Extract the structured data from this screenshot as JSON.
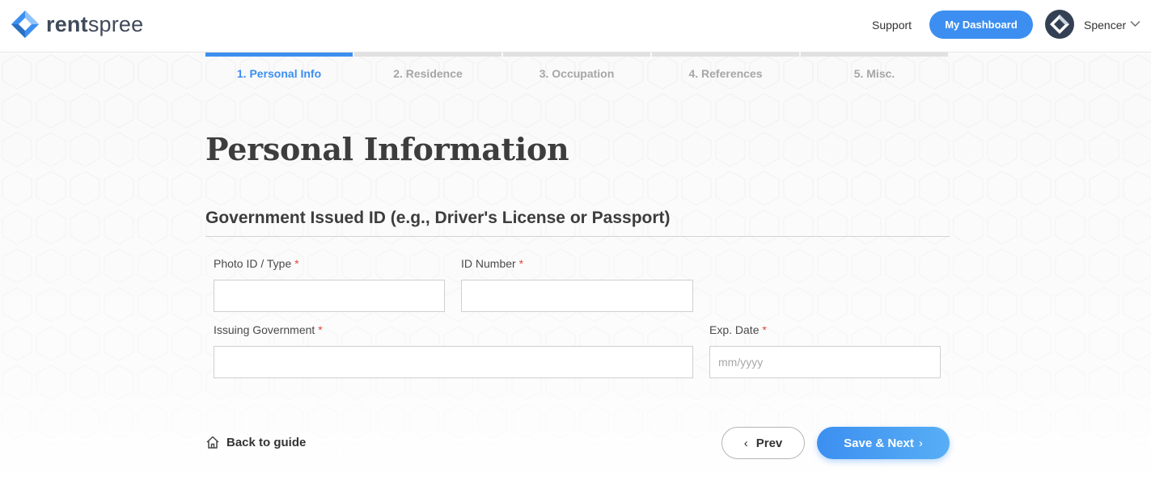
{
  "header": {
    "logo_text_strong": "rent",
    "logo_text_rest": "spree",
    "support_label": "Support",
    "dashboard_label": "My Dashboard",
    "user_name": "Spencer",
    "brand_color": "#3c8ff0"
  },
  "steps": [
    {
      "label": "1. Personal Info",
      "active": true
    },
    {
      "label": "2. Residence",
      "active": false
    },
    {
      "label": "3. Occupation",
      "active": false
    },
    {
      "label": "4. References",
      "active": false
    },
    {
      "label": "5. Misc.",
      "active": false
    }
  ],
  "page_title": "Personal Information",
  "section_title": "Government Issued ID (e.g., Driver's License or Passport)",
  "fields": {
    "photo_id": {
      "label": "Photo ID / Type",
      "required_mark": "*",
      "value": "",
      "placeholder": ""
    },
    "id_number": {
      "label": "ID Number",
      "required_mark": "*",
      "value": "",
      "placeholder": ""
    },
    "issuing_government": {
      "label": "Issuing Government",
      "required_mark": "*",
      "value": "",
      "placeholder": ""
    },
    "exp_date": {
      "label": "Exp. Date",
      "required_mark": "*",
      "value": "",
      "placeholder": "mm/yyyy"
    }
  },
  "footer": {
    "back_label": "Back to guide",
    "prev_label": "Prev",
    "next_label": "Save & Next",
    "prev_chevron": "‹",
    "next_chevron": "›"
  },
  "icons": {
    "logo": "rentspree-diamond-logo",
    "avatar": "user-avatar-diamond",
    "user_menu": "chevron-down-icon",
    "back": "home-icon"
  }
}
